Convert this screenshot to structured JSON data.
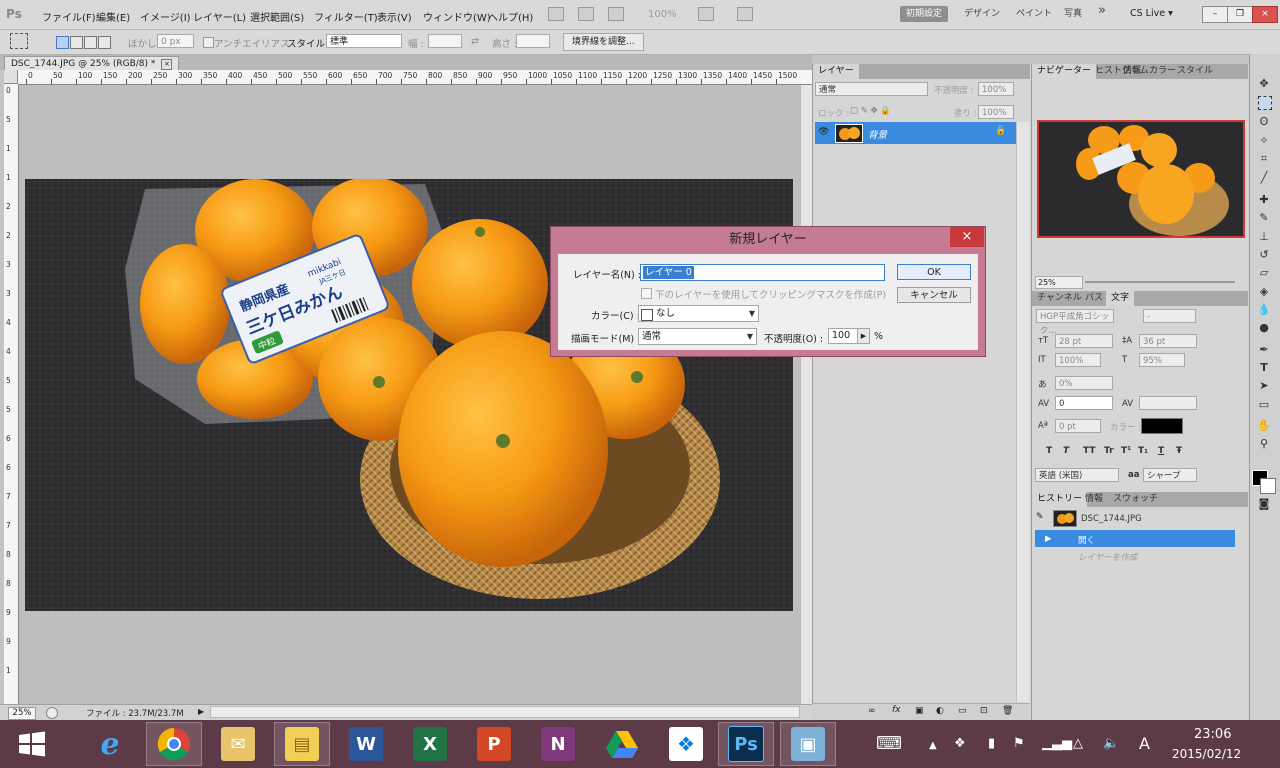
{
  "app": {
    "logo": "Ps",
    "menus": [
      "ファイル(F)",
      "編集(E)",
      "イメージ(I)",
      "レイヤー(L)",
      "選択範囲(S)",
      "フィルター(T)",
      "表示(V)",
      "ウィンドウ(W)",
      "ヘルプ(H)"
    ],
    "zoom_readout": "100%",
    "workspaces": [
      "初期設定",
      "デザイン",
      "ペイント",
      "写真"
    ],
    "overflow": "»",
    "cs_live": "CS Live ▾"
  },
  "options_bar": {
    "feather_label": "ぼかし :",
    "feather_value": "0 px",
    "antialias_label": "アンチエイリアス",
    "style_label": "スタイル :",
    "style_value": "標準",
    "width_label": "幅 :",
    "height_label": "高さ :",
    "refine_edge": "境界線を調整..."
  },
  "document": {
    "tab_title": "DSC_1744.JPG @ 25% (RGB/8) *",
    "close": "×",
    "ruler_top": [
      "0",
      "50",
      "100",
      "150",
      "200",
      "250",
      "300",
      "350",
      "400",
      "450",
      "500",
      "550",
      "600",
      "650",
      "700",
      "750",
      "800",
      "850",
      "900",
      "950",
      "1000",
      "1050",
      "1100",
      "1150",
      "1200",
      "1250",
      "1300",
      "1350",
      "1400",
      "1450",
      "1500",
      "1550"
    ],
    "ruler_left": [
      "0",
      "5",
      "1 0",
      "1 5",
      "2 0",
      "2 5",
      "3 0",
      "3 5",
      "4 0",
      "4 5",
      "5 0",
      "5 5",
      "6 0",
      "6 5",
      "7 0",
      "7 5",
      "8 0",
      "8 5",
      "9 0",
      "9 5",
      "1 0 0"
    ],
    "status_zoom": "25%",
    "file_info": "ファイル : 23.7M/23.7M"
  },
  "layers_panel": {
    "tab": "レイヤー",
    "blend_mode": "通常",
    "opacity_label": "不透明度 :",
    "opacity_value": "100%",
    "lock_label": "ロック :",
    "fill_label": "塗り :",
    "fill_value": "100%",
    "layer_name": "背景"
  },
  "navigator": {
    "tabs": [
      "ナビゲーター",
      "ヒストグラム",
      "情報",
      "カラー",
      "スタイル"
    ],
    "zoom": "25%"
  },
  "character": {
    "tabs": [
      "チャンネル",
      "パス",
      "文字"
    ],
    "font_family": "HGP平成角ゴシック...",
    "font_style": "-",
    "font_size": "28 pt",
    "leading": "36 pt",
    "vertical_scale": "100%",
    "horizontal_scale": "95%",
    "tsume": "0%",
    "kerning": "0",
    "baseline_shift": "0 pt",
    "color_label": "カラー :",
    "language": "英語 (米国)",
    "antialias": "シャープ",
    "aa_symbol": "aa",
    "typo_buttons": [
      "T",
      "T",
      "TT",
      "Tr",
      "T¹",
      "T₁",
      "T",
      "Ŧ"
    ]
  },
  "history": {
    "tabs": [
      "ヒストリー",
      "情報",
      "スウォッチ"
    ],
    "snapshot": "DSC_1744.JPG",
    "items": [
      "開く",
      "レイヤーを作成"
    ]
  },
  "dialog": {
    "title": "新規レイヤー",
    "close": "×",
    "name_label": "レイヤー名(N) :",
    "name_value": "レイヤー 0",
    "ok": "OK",
    "cancel": "キャンセル",
    "clip_label": "下のレイヤーを使用してクリッピングマスクを作成(P)",
    "color_label": "カラー(C) :",
    "color_value": "なし",
    "mode_label": "描画モード(M) :",
    "mode_value": "通常",
    "opacity_label": "不透明度(O) :",
    "opacity_value": "100",
    "opacity_unit": "%"
  },
  "photo_label": {
    "line1": "静岡県産",
    "line2": "三ケ日みかん",
    "brand": "mikkabi",
    "coop": "JA三ケ日",
    "size": "中粒"
  },
  "taskbar": {
    "time": "23:06",
    "date": "2015/02/12",
    "ime": "A",
    "word": "W",
    "excel": "X",
    "powerpoint": "P",
    "onenote": "N",
    "photoshop": "Ps"
  },
  "colors": {
    "accent": "#3a8ae0",
    "dialog_frame": "#c57c93",
    "close_red": "#c8393d",
    "taskbar": "#5d3a48"
  }
}
